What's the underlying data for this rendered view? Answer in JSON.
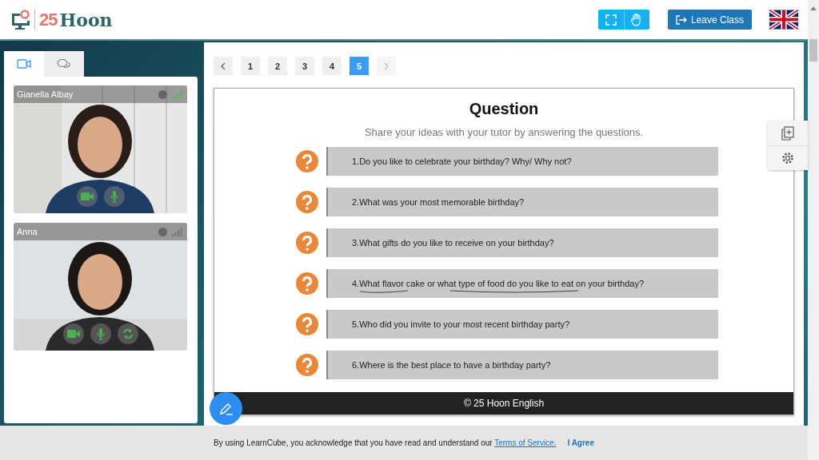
{
  "header": {
    "logo": {
      "number": "25",
      "name": "Hoon"
    },
    "leave_button": "Leave Class"
  },
  "side_tabs": [
    {
      "kind": "video",
      "selected": true
    },
    {
      "kind": "chat",
      "selected": false
    }
  ],
  "participants": [
    {
      "name": "Gianella Albay",
      "color": "#5cb85c",
      "controls": [
        {
          "kind": "camera"
        },
        {
          "kind": "mic"
        }
      ]
    },
    {
      "name": "Anna",
      "color": "#777777",
      "controls": [
        {
          "kind": "camera"
        },
        {
          "kind": "mic"
        },
        {
          "kind": "switch"
        }
      ]
    }
  ],
  "pages": [
    {
      "label": "1",
      "selected": false
    },
    {
      "label": "2",
      "selected": false
    },
    {
      "label": "3",
      "selected": false
    },
    {
      "label": "4",
      "selected": false
    },
    {
      "label": "5",
      "selected": true
    }
  ],
  "next_disabled": true,
  "slide": {
    "title": "Question",
    "subtitle": "Share your ideas with your tutor by answering the questions.",
    "questions": [
      {
        "text": "1.Do you like to celebrate your birthday? Why/ Why not?",
        "annotated": false
      },
      {
        "text": "2.What was your most memorable birthday?",
        "annotated": false
      },
      {
        "text": "3.What gifts do you like to receive on your birthday?",
        "annotated": false
      },
      {
        "text": "4.What flavor cake or what type of food do you like to eat on your birthday?",
        "annotated": true
      },
      {
        "text": "5.Who did you invite to your most recent birthday party?",
        "annotated": false
      },
      {
        "text": "6.Where is the best place to have a birthday party?",
        "annotated": false
      }
    ],
    "footer": "© 25 Hoon English"
  },
  "cookie_bar": {
    "text": "By using LearnCube, you acknowledge that you have read and understand our",
    "link": "Terms of Service.",
    "agree": "I Agree"
  }
}
